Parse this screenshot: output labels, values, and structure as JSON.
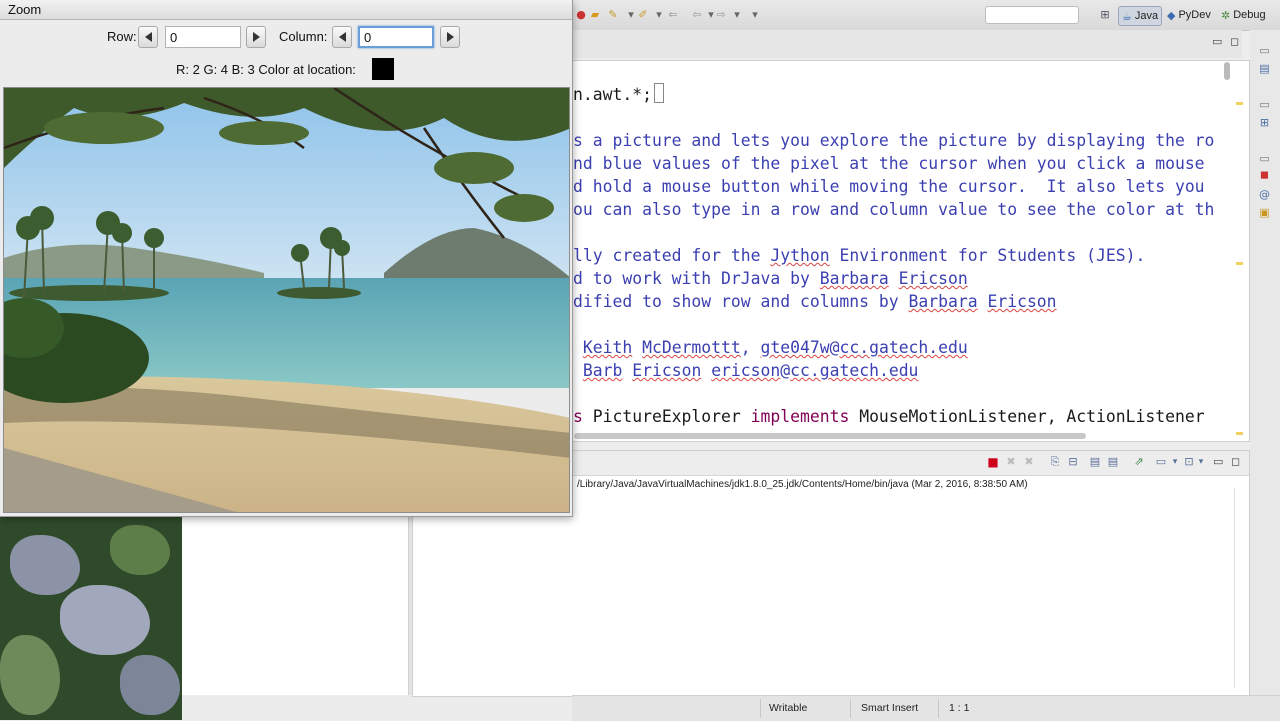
{
  "zoom_window": {
    "title": "Zoom",
    "row_label": "Row:",
    "row_value": "0",
    "column_label": "Column:",
    "column_value": "0",
    "color_info": "R: 2 G: 4 B: 3 Color at location:",
    "color_swatch": "#000000"
  },
  "toolbar": {
    "perspectives": [
      {
        "label": "Java",
        "icon": "java-perspective-icon",
        "active": true
      },
      {
        "label": "PyDev",
        "icon": "pydev-perspective-icon",
        "active": false
      },
      {
        "label": "Debug",
        "icon": "debug-perspective-icon",
        "active": false
      }
    ]
  },
  "editor": {
    "lines": [
      {
        "parts": [
          {
            "t": "n.awt.*;",
            "c": ""
          }
        ],
        "cursor": true
      },
      {
        "parts": [
          {
            "t": "",
            "c": ""
          }
        ]
      },
      {
        "parts": [
          {
            "t": "s a picture and lets you explore the picture by displaying the ro",
            "c": "cm"
          }
        ]
      },
      {
        "parts": [
          {
            "t": "nd blue values of the pixel at the cursor when you click a mouse",
            "c": "cm"
          }
        ]
      },
      {
        "parts": [
          {
            "t": "d hold a mouse button while moving the cursor.  It also lets you",
            "c": "cm"
          }
        ]
      },
      {
        "parts": [
          {
            "t": "ou can also type in a row and column value to see the color at th",
            "c": "cm"
          }
        ]
      },
      {
        "parts": [
          {
            "t": "",
            "c": ""
          }
        ]
      },
      {
        "parts": [
          {
            "t": "lly created for the ",
            "c": "cm"
          },
          {
            "t": "Jython",
            "c": "cm sq"
          },
          {
            "t": " Environment for Students (JES).",
            "c": "cm"
          }
        ]
      },
      {
        "parts": [
          {
            "t": "d to work with DrJava by ",
            "c": "cm"
          },
          {
            "t": "Barbara",
            "c": "cm sq"
          },
          {
            "t": " ",
            "c": "cm"
          },
          {
            "t": "Ericson",
            "c": "cm sq"
          }
        ]
      },
      {
        "parts": [
          {
            "t": "dified to show row and columns by ",
            "c": "cm"
          },
          {
            "t": "Barbara",
            "c": "cm sq"
          },
          {
            "t": " ",
            "c": "cm"
          },
          {
            "t": "Ericson",
            "c": "cm sq"
          }
        ]
      },
      {
        "parts": [
          {
            "t": "",
            "c": ""
          }
        ]
      },
      {
        "parts": [
          {
            "t": " ",
            "c": "cm"
          },
          {
            "t": "Keith",
            "c": "cm sq"
          },
          {
            "t": " ",
            "c": "cm"
          },
          {
            "t": "McDermottt",
            "c": "cm sq"
          },
          {
            "t": ", ",
            "c": "cm"
          },
          {
            "t": "gte047w",
            "c": "cm sq"
          },
          {
            "t": "@",
            "c": "cm"
          },
          {
            "t": "cc.gatech.edu",
            "c": "cm sq"
          }
        ]
      },
      {
        "parts": [
          {
            "t": " ",
            "c": "cm"
          },
          {
            "t": "Barb",
            "c": "cm sq"
          },
          {
            "t": " ",
            "c": "cm"
          },
          {
            "t": "Ericson",
            "c": "cm sq"
          },
          {
            "t": " ",
            "c": "cm"
          },
          {
            "t": "ericson",
            "c": "cm sq"
          },
          {
            "t": "@",
            "c": "cm"
          },
          {
            "t": "cc.gatech.edu",
            "c": "cm sq"
          }
        ]
      },
      {
        "parts": [
          {
            "t": "",
            "c": ""
          }
        ]
      },
      {
        "parts": [
          {
            "t": "s",
            "c": "kw"
          },
          {
            "t": " PictureExplorer ",
            "c": ""
          },
          {
            "t": "implements",
            "c": "kw"
          },
          {
            "t": " MouseMotionListener, ActionListener",
            "c": ""
          }
        ]
      }
    ]
  },
  "console": {
    "launch_line": "/Library/Java/JavaVirtualMachines/jdk1.8.0_25.jdk/Contents/Home/bin/java (Mar 2, 2016, 8:38:50 AM)"
  },
  "statusbar": {
    "writable": "Writable",
    "insert_mode": "Smart Insert",
    "position": "1 : 1"
  },
  "colors": {
    "comment": "#3b3fb0",
    "keyword": "#7f0055",
    "terminate_red": "#d0021b",
    "focus_ring": "#6a9ed9"
  }
}
